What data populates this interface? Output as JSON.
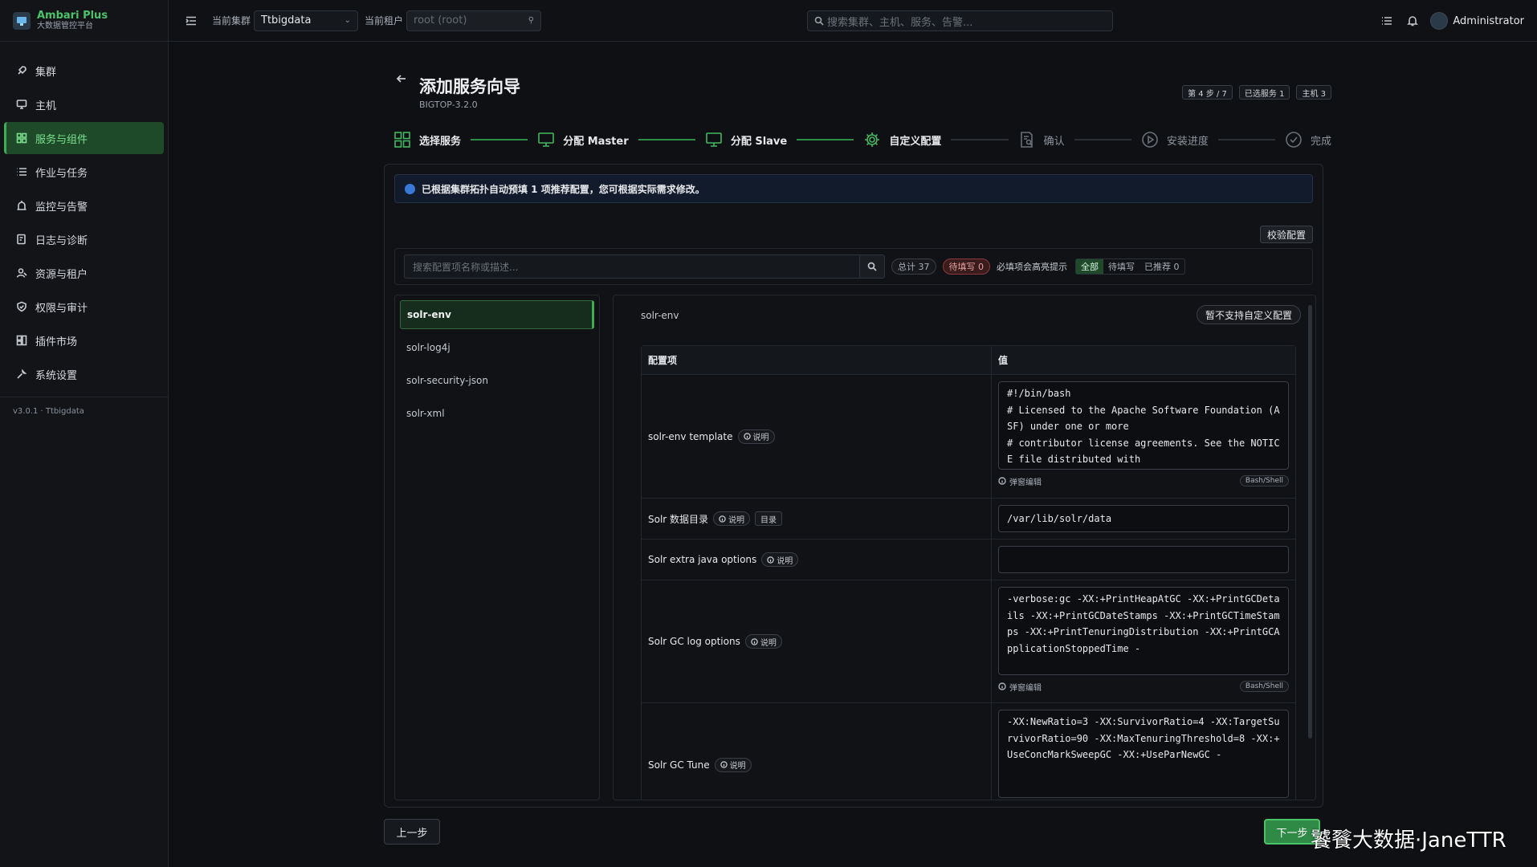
{
  "brand": {
    "title": "Ambari Plus",
    "subtitle": "大数据管控平台"
  },
  "sidebar": {
    "items": [
      {
        "label": "集群",
        "icon": "rocket-icon"
      },
      {
        "label": "主机",
        "icon": "monitor-icon"
      },
      {
        "label": "服务与组件",
        "icon": "grid-icon",
        "active": true
      },
      {
        "label": "作业与任务",
        "icon": "list-icon"
      },
      {
        "label": "监控与告警",
        "icon": "alarm-icon"
      },
      {
        "label": "日志与诊断",
        "icon": "log-icon"
      },
      {
        "label": "资源与租户",
        "icon": "users-icon"
      },
      {
        "label": "权限与审计",
        "icon": "shield-icon"
      },
      {
        "label": "插件市场",
        "icon": "plugin-icon"
      },
      {
        "label": "系统设置",
        "icon": "wrench-icon"
      }
    ],
    "version": "v3.0.1 · Ttbigdata"
  },
  "topbar": {
    "cluster_label": "当前集群",
    "cluster_value": "Ttbigdata",
    "tenant_label": "当前租户",
    "tenant_placeholder": "root (root)",
    "search_placeholder": "搜索集群、主机、服务、告警...",
    "user": "Administrator"
  },
  "wizard": {
    "title": "添加服务向导",
    "subtitle": "BIGTOP-3.2.0",
    "badges": [
      "第 4 步 / 7",
      "已选服务 1",
      "主机 3"
    ],
    "steps": [
      {
        "label": "选择服务",
        "state": "done",
        "icon": "grid-icon"
      },
      {
        "label": "分配 Master",
        "state": "done",
        "icon": "monitor-icon"
      },
      {
        "label": "分配 Slave",
        "state": "done",
        "icon": "monitor-icon"
      },
      {
        "label": "自定义配置",
        "state": "done",
        "icon": "gear-icon"
      },
      {
        "label": "确认",
        "state": "todo",
        "icon": "doc-search-icon"
      },
      {
        "label": "安装进度",
        "state": "todo",
        "icon": "play-circle-icon"
      },
      {
        "label": "完成",
        "state": "todo",
        "icon": "check-circle-icon"
      }
    ],
    "banner": "已根据集群拓扑自动预填 1 项推荐配置，您可根据实际需求修改。",
    "validate_label": "校验配置",
    "search_placeholder": "搜索配置项名称或描述...",
    "total": "总计 37",
    "pending": "待填写 0",
    "hint": "必填项会高亮提示",
    "filters": [
      "全部",
      "待填写",
      "已推荐 0"
    ],
    "config_groups": [
      "solr-env",
      "solr-log4j",
      "solr-security-json",
      "solr-xml"
    ],
    "pane_title": "solr-env",
    "pane_button": "暂不支持自定义配置",
    "col_key": "配置项",
    "col_value": "值",
    "desc_label": "说明",
    "dir_label": "目录",
    "popup_label": "弹窗编辑",
    "lang_label": "Bash/Shell",
    "rows": [
      {
        "name": "solr-env template",
        "value": "#!/bin/bash\n# Licensed to the Apache Software Foundation (ASF) under one or more\n# contributor license agreements. See the NOTICE file distributed with"
      },
      {
        "name": "Solr 数据目录",
        "value": "/var/lib/solr/data"
      },
      {
        "name": "Solr extra java options",
        "value": ""
      },
      {
        "name": "Solr GC log options",
        "value": "-verbose:gc -XX:+PrintHeapAtGC -XX:+PrintGCDetails -XX:+PrintGCDateStamps -XX:+PrintGCTimeStamps -XX:+PrintTenuringDistribution -XX:+PrintGCApplicationStoppedTime -"
      },
      {
        "name": "Solr GC Tune",
        "value": "-XX:NewRatio=3 -XX:SurvivorRatio=4 -XX:TargetSurvivorRatio=90 -XX:MaxTenuringThreshold=8 -XX:+UseConcMarkSweepGC -XX:+UseParNewGC -"
      }
    ],
    "prev_label": "上一步",
    "next_label": "下一步"
  },
  "watermark": "饕餮大数据·JaneTTR"
}
